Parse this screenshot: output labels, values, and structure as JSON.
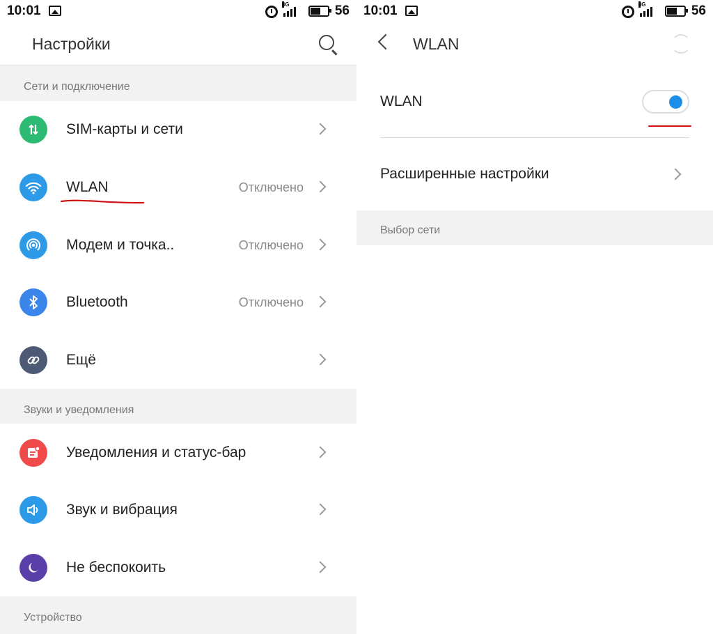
{
  "left": {
    "status": {
      "time": "10:01",
      "network": "3G",
      "battery": "56"
    },
    "header": {
      "title": "Настройки",
      "search_icon": "search-icon"
    },
    "sections": [
      {
        "title": "Сети и подключение",
        "items": [
          {
            "label": "SIM-карты и сети",
            "value": "",
            "icon": "sim-arrows-icon",
            "color": "#2dbb73"
          },
          {
            "label": "WLAN",
            "value": "Отключено",
            "icon": "wifi-icon",
            "color": "#2d9ae8"
          },
          {
            "label": "Модем и точка..",
            "value": "Отключено",
            "icon": "hotspot-icon",
            "color": "#2d9ae8"
          },
          {
            "label": "Bluetooth",
            "value": "Отключено",
            "icon": "bluetooth-icon",
            "color": "#3a86ea"
          },
          {
            "label": "Ещё",
            "value": "",
            "icon": "link-icon",
            "color": "#4d5a75"
          }
        ]
      },
      {
        "title": "Звуки и уведомления",
        "items": [
          {
            "label": "Уведомления и статус-бар",
            "value": "",
            "icon": "notification-icon",
            "color": "#f04a4a"
          },
          {
            "label": "Звук и вибрация",
            "value": "",
            "icon": "speaker-icon",
            "color": "#2d9ae8"
          },
          {
            "label": "Не беспокоить",
            "value": "",
            "icon": "moon-icon",
            "color": "#5a3fa8"
          }
        ]
      },
      {
        "title": "Устройство",
        "items": []
      }
    ]
  },
  "right": {
    "status": {
      "time": "10:01",
      "network": "3G",
      "battery": "56"
    },
    "header": {
      "title": "WLAN",
      "back_icon": "back-icon",
      "refresh_icon": "refresh-icon"
    },
    "wlan_toggle": {
      "label": "WLAN",
      "state": "on",
      "accent": "#1e8fe8"
    },
    "advanced": {
      "label": "Расширенные настройки"
    },
    "network_section": {
      "title": "Выбор сети"
    }
  },
  "annotation_color": "#d01010"
}
